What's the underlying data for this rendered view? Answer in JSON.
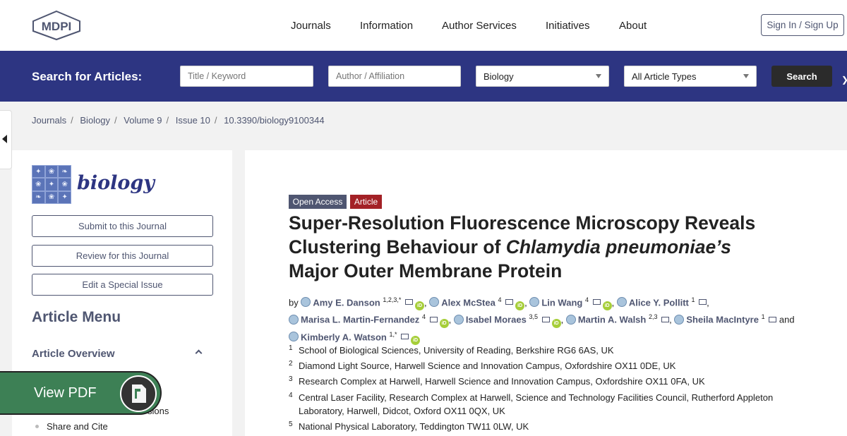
{
  "header": {
    "logo_text": "MDPI",
    "nav": [
      "Journals",
      "Information",
      "Author Services",
      "Initiatives",
      "About"
    ],
    "signin": "Sign In / Sign Up"
  },
  "search": {
    "label": "Search for Articles:",
    "title_placeholder": "Title / Keyword",
    "author_placeholder": "Author / Affiliation",
    "journal_value": "Biology",
    "type_value": "All Article Types",
    "button": "Search"
  },
  "breadcrumb": [
    "Journals",
    "Biology",
    "Volume 9",
    "Issue 10",
    "10.3390/biology9100344"
  ],
  "sidebar": {
    "journal_name": "biology",
    "buttons": [
      "Submit to this Journal",
      "Review for this Journal",
      "Edit a Special Issue"
    ],
    "menu_title": "Article Menu",
    "overview": "Article Overview",
    "items": [
      "sions",
      "Share and Cite"
    ]
  },
  "viewpdf": {
    "label": "View PDF"
  },
  "article": {
    "badges": [
      "Open Access",
      "Article"
    ],
    "title_line1": "Super-Resolution Fluorescence Microscopy Reveals",
    "title_line2a": "Clustering Behaviour of ",
    "title_line2b": "Chlamydia pneumoniae’s",
    "title_line3": "Major Outer Membrane Protein",
    "by": "by",
    "and": "and",
    "authors": [
      {
        "name": "Amy E. Danson",
        "sup": "1,2,3,*"
      },
      {
        "name": "Alex McStea",
        "sup": "4"
      },
      {
        "name": "Lin Wang",
        "sup": "4"
      },
      {
        "name": "Alice Y. Pollitt",
        "sup": "1"
      },
      {
        "name": "Marisa L. Martin-Fernandez",
        "sup": "4"
      },
      {
        "name": "Isabel Moraes",
        "sup": "3,5"
      },
      {
        "name": "Martin A. Walsh",
        "sup": "2,3"
      },
      {
        "name": "Sheila MacIntyre",
        "sup": "1"
      },
      {
        "name": "Kimberly A. Watson",
        "sup": "1,*"
      }
    ],
    "affiliations": [
      {
        "num": "1",
        "text": "School of Biological Sciences, University of Reading, Berkshire RG6 6AS, UK"
      },
      {
        "num": "2",
        "text": "Diamond Light Source, Harwell Science and Innovation Campus, Oxfordshire OX11 0DE, UK"
      },
      {
        "num": "3",
        "text": "Research Complex at Harwell, Harwell Science and Innovation Campus, Oxfordshire OX11 0FA, UK"
      },
      {
        "num": "4",
        "text": "Central Laser Facility, Research Complex at Harwell, Science and Technology Facilities Council, Rutherford Appleton Laboratory, Harwell, Didcot, Oxford OX11 0QX, UK"
      },
      {
        "num": "5",
        "text": "National Physical Laboratory, Teddington TW11 0LW, UK"
      }
    ]
  },
  "colors": {
    "brand_blue": "#2d3582",
    "link": "#4f5671",
    "open_access_badge": "#4f5671",
    "article_badge": "#a32126",
    "viewpdf_green": "#3d8055",
    "orcid_green": "#a6ce39"
  }
}
